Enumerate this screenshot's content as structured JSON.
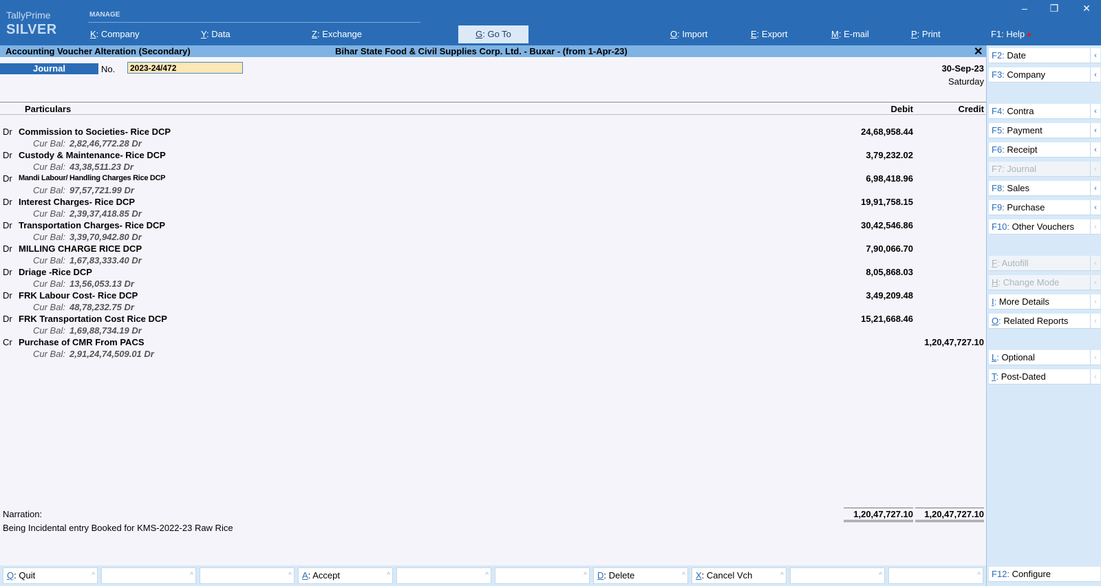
{
  "app": {
    "name": "TallyPrime",
    "edition": "SILVER",
    "menu_group": "MANAGE"
  },
  "topmenu": [
    {
      "key": "K",
      "label": "Company"
    },
    {
      "key": "Y",
      "label": "Data"
    },
    {
      "key": "Z",
      "label": "Exchange"
    },
    {
      "key": "G",
      "label": "Go To"
    },
    {
      "key": "O",
      "label": "Import"
    },
    {
      "key": "E",
      "label": "Export"
    },
    {
      "key": "M",
      "label": "E-mail"
    },
    {
      "key": "P",
      "label": "Print"
    },
    {
      "key": "F1",
      "label": "Help"
    }
  ],
  "window_controls": {
    "minimize": "–",
    "restore": "❐",
    "close": "✕"
  },
  "titlebar": {
    "screen": "Accounting Voucher Alteration (Secondary)",
    "company": "Bihar State Food & Civil Supplies Corp. Ltd. - Buxar - (from 1-Apr-23)",
    "close": "✕"
  },
  "voucher": {
    "type": "Journal",
    "no_label": "No.",
    "number": "2023-24/472",
    "date": "30-Sep-23",
    "day": "Saturday"
  },
  "columns": {
    "particulars": "Particulars",
    "debit": "Debit",
    "credit": "Credit"
  },
  "cur_bal_label": "Cur Bal:",
  "entries": [
    {
      "drcr": "Dr",
      "ledger": "Commission to Societies- Rice DCP",
      "cur_bal": "2,82,46,772.28 Dr",
      "debit": "24,68,958.44",
      "credit": ""
    },
    {
      "drcr": "Dr",
      "ledger": "Custody & Maintenance- Rice DCP",
      "cur_bal": "43,38,511.23 Dr",
      "debit": "3,79,232.02",
      "credit": ""
    },
    {
      "drcr": "Dr",
      "ledger": "Mandi Labour/ Handling Charges Rice DCP",
      "cur_bal": "97,57,721.99 Dr",
      "debit": "6,98,418.96",
      "credit": ""
    },
    {
      "drcr": "Dr",
      "ledger": "Interest Charges- Rice DCP",
      "cur_bal": "2,39,37,418.85 Dr",
      "debit": "19,91,758.15",
      "credit": ""
    },
    {
      "drcr": "Dr",
      "ledger": "Transportation Charges- Rice DCP",
      "cur_bal": "3,39,70,942.80 Dr",
      "debit": "30,42,546.86",
      "credit": ""
    },
    {
      "drcr": "Dr",
      "ledger": "MILLING CHARGE RICE DCP",
      "cur_bal": "1,67,83,333.40 Dr",
      "debit": "7,90,066.70",
      "credit": ""
    },
    {
      "drcr": "Dr",
      "ledger": "Driage -Rice DCP",
      "cur_bal": "13,56,053.13 Dr",
      "debit": "8,05,868.03",
      "credit": ""
    },
    {
      "drcr": "Dr",
      "ledger": "FRK Labour Cost- Rice DCP",
      "cur_bal": "48,78,232.75 Dr",
      "debit": "3,49,209.48",
      "credit": ""
    },
    {
      "drcr": "Dr",
      "ledger": "FRK Transportation Cost Rice DCP",
      "cur_bal": "1,69,88,734.19 Dr",
      "debit": "15,21,668.46",
      "credit": ""
    },
    {
      "drcr": "Cr",
      "ledger": "Purchase of CMR From PACS",
      "cur_bal": "2,91,24,74,509.01 Dr",
      "debit": "",
      "credit": "1,20,47,727.10"
    }
  ],
  "narration": {
    "label": "Narration:",
    "text": "Being Incidental entry Booked for KMS-2022-23 Raw Rice"
  },
  "totals": {
    "debit": "1,20,47,727.10",
    "credit": "1,20,47,727.10"
  },
  "right_panel": [
    {
      "key": "F2",
      "label": "Date",
      "enabled": true
    },
    {
      "key": "F3",
      "label": "Company",
      "enabled": true
    },
    {
      "key": "F4",
      "label": "Contra",
      "enabled": true
    },
    {
      "key": "F5",
      "label": "Payment",
      "enabled": true
    },
    {
      "key": "F6",
      "label": "Receipt",
      "enabled": true
    },
    {
      "key": "F7",
      "label": "Journal",
      "enabled": false
    },
    {
      "key": "F8",
      "label": "Sales",
      "enabled": true
    },
    {
      "key": "F9",
      "label": "Purchase",
      "enabled": true
    },
    {
      "key": "F10",
      "label": "Other Vouchers",
      "enabled": true
    },
    {
      "key": "F",
      "label": "Autofill",
      "enabled": false
    },
    {
      "key": "H",
      "label": "Change Mode",
      "enabled": false
    },
    {
      "key": "I",
      "label": "More Details",
      "enabled": true
    },
    {
      "key": "O",
      "label": "Related Reports",
      "enabled": true
    },
    {
      "key": "L",
      "label": "Optional",
      "enabled": true
    },
    {
      "key": "T",
      "label": "Post-Dated",
      "enabled": true
    },
    {
      "key": "F12",
      "label": "Configure",
      "enabled": true
    }
  ],
  "bottom_bar": [
    {
      "key": "Q",
      "label": "Quit"
    },
    {
      "key": "",
      "label": ""
    },
    {
      "key": "",
      "label": ""
    },
    {
      "key": "A",
      "label": "Accept"
    },
    {
      "key": "",
      "label": ""
    },
    {
      "key": "",
      "label": ""
    },
    {
      "key": "D",
      "label": "Delete"
    },
    {
      "key": "X",
      "label": "Cancel Vch"
    },
    {
      "key": "",
      "label": ""
    },
    {
      "key": "",
      "label": ""
    }
  ],
  "colors": {
    "brand_blue": "#2a6db6",
    "title_bar": "#7fb3e3",
    "panel_bg": "#d7e9f8",
    "field_bg": "#fde7b5",
    "page_bg": "#f6f4fb"
  }
}
